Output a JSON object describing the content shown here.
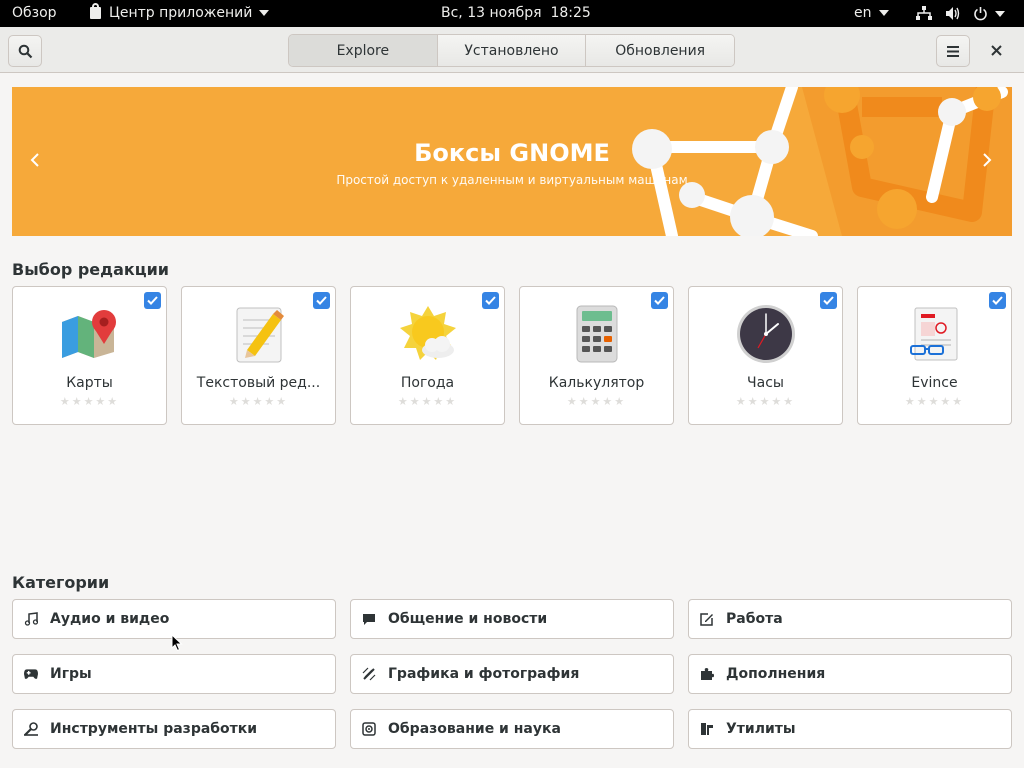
{
  "topbar": {
    "activities": "Обзор",
    "app_menu": "Центр приложений",
    "clock": "Вс, 13 ноября  18:25",
    "lang": "en",
    "icons": [
      "network-icon",
      "volume-icon",
      "power-icon"
    ]
  },
  "header": {
    "tabs": [
      {
        "label": "Explore",
        "active": true
      },
      {
        "label": "Установлено",
        "active": false
      },
      {
        "label": "Обновления",
        "active": false
      }
    ],
    "icons": [
      "search-icon",
      "menu-icon",
      "close-icon"
    ]
  },
  "banner": {
    "title": "Боксы GNOME",
    "subtitle": "Простой доступ к удаленным и виртуальным машинам",
    "color": "#f6a93a"
  },
  "editors_picks": {
    "heading": "Выбор редакции",
    "apps": [
      {
        "name": "Карты",
        "icon": "maps-icon"
      },
      {
        "name": "Текстовый ред...",
        "icon": "text-editor-icon"
      },
      {
        "name": "Погода",
        "icon": "weather-icon"
      },
      {
        "name": "Калькулятор",
        "icon": "calculator-icon"
      },
      {
        "name": "Часы",
        "icon": "clock-icon"
      },
      {
        "name": "Evince",
        "icon": "document-viewer-icon"
      }
    ]
  },
  "categories": {
    "heading": "Категории",
    "items": [
      {
        "label": "Аудио и видео",
        "icon": "music-note-icon"
      },
      {
        "label": "Общение и новости",
        "icon": "chat-bubble-icon"
      },
      {
        "label": "Работа",
        "icon": "edit-icon"
      },
      {
        "label": "Игры",
        "icon": "gamepad-icon"
      },
      {
        "label": "Графика и фотография",
        "icon": "graphics-icon"
      },
      {
        "label": "Дополнения",
        "icon": "puzzle-icon"
      },
      {
        "label": "Инструменты разработки",
        "icon": "dev-tools-icon"
      },
      {
        "label": "Образование и наука",
        "icon": "science-icon"
      },
      {
        "label": "Утилиты",
        "icon": "utilities-icon"
      }
    ]
  },
  "colors": {
    "accent": "#3584e4",
    "banner": "#f6a93a"
  }
}
